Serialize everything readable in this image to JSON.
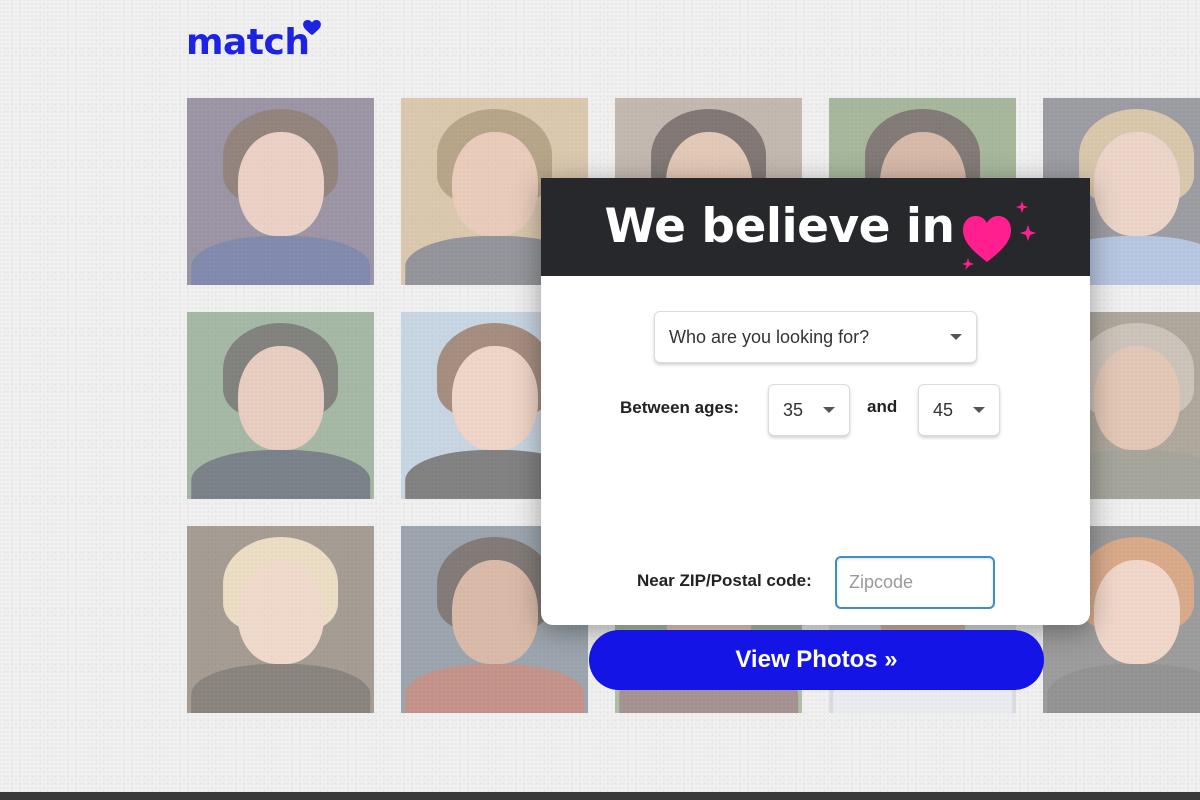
{
  "brand": {
    "logo_text": "match",
    "logo_color": "#1d23e3"
  },
  "photos": [
    {
      "bg": "#5a4e6a",
      "hair": "#4a2e22",
      "face": "#e7b9a4",
      "body": "#2a3a7a"
    },
    {
      "bg": "#c9a87a",
      "hair": "#8a6a3a",
      "face": "#e3b091",
      "body": "#4a4e56"
    },
    {
      "bg": "#a08c7c",
      "hair": "#2a1a14",
      "face": "#d9a98a",
      "body": "#3a2a22"
    },
    {
      "bg": "#6c8a5a",
      "hair": "#2a1e16",
      "face": "#c48e70",
      "body": "#5a5a5a"
    },
    {
      "bg": "#5a5a66",
      "hair": "#c8a876",
      "face": "#eac0a8",
      "body": "#8aa6d6"
    },
    {
      "bg": "#6a8a6a",
      "hair": "#2a2a24",
      "face": "#e2b39a",
      "body": "#1e2a3a"
    },
    {
      "bg": "#a8c0d8",
      "hair": "#6a3e26",
      "face": "#eec0a6",
      "body": "#2a2a2a"
    },
    {
      "bg": "#7a6e5a",
      "hair": "#b0a090",
      "face": "#d9a688",
      "body": "#6a6a5a"
    },
    {
      "bg": "#6a5a4a",
      "hair": "#e8d0a0",
      "face": "#f0c8b0",
      "body": "#3a2e26"
    },
    {
      "bg": "#5a6a7a",
      "hair": "#2a1e16",
      "face": "#c89070",
      "body": "#a04a3a"
    },
    {
      "bg": "#7a9a6a",
      "hair": "#8a5a36",
      "face": "#e8b49a",
      "body": "#6a4a4a"
    },
    {
      "bg": "#c8ccd0",
      "hair": "#d0d4da",
      "face": "#b88868",
      "body": "#e4e8f0"
    },
    {
      "bg": "#5a5a5a",
      "hair": "#c8743a",
      "face": "#f0c4aa",
      "body": "#4a4a4a"
    }
  ],
  "modal": {
    "title": "We believe in",
    "heart_color": "#ff1f8e",
    "header_bg": "#27282b",
    "looking_for": {
      "value": "Who are you looking for?"
    },
    "ages_label": "Between ages:",
    "age_min": "35",
    "and_label": "and",
    "age_max": "45",
    "zip_label": "Near ZIP/Postal code:",
    "zip_placeholder": "Zipcode",
    "zip_value": "",
    "submit_label": "View Photos »",
    "submit_color": "#1414e6"
  }
}
